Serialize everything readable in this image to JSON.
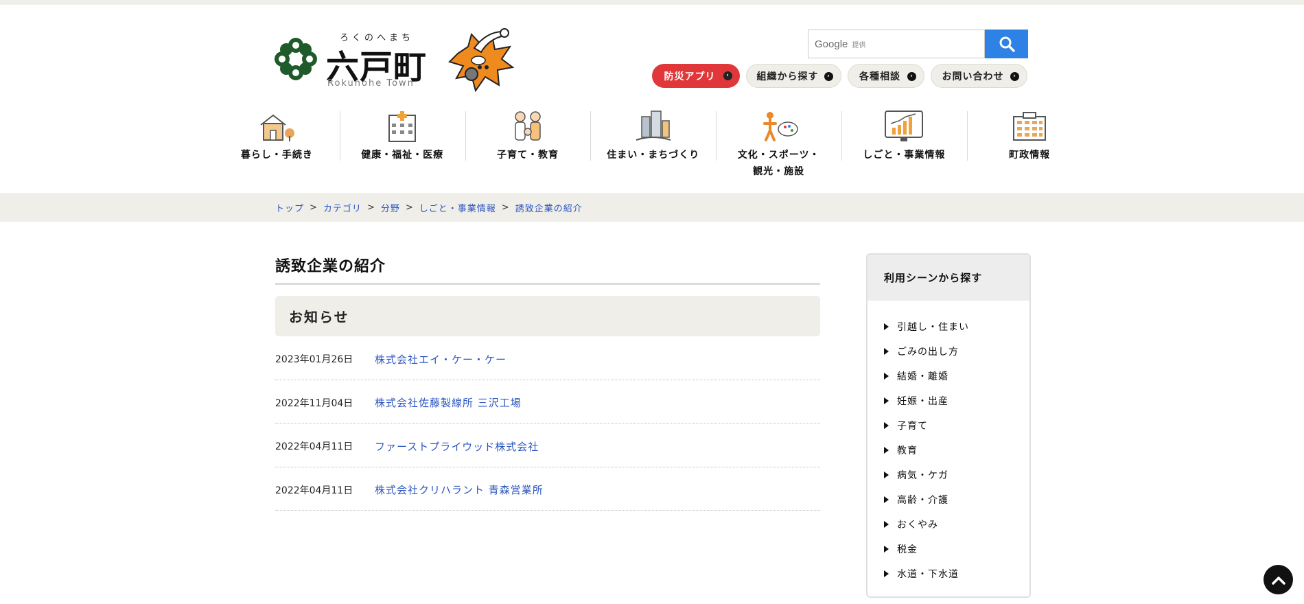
{
  "header": {
    "logo_ruby": "ろくのへまち",
    "logo_name": "六戸町",
    "logo_en": "Rokunohe Town",
    "search": {
      "brand": "Google",
      "provided": "提供",
      "placeholder": ""
    },
    "top_links": [
      {
        "label": "防災アプリ",
        "style": "red"
      },
      {
        "label": "組織から探す",
        "style": "grey"
      },
      {
        "label": "各種相談",
        "style": "grey"
      },
      {
        "label": "お問い合わせ",
        "style": "grey"
      }
    ]
  },
  "gnav": [
    {
      "label": "暮らし・手続き",
      "icon": "house-icon"
    },
    {
      "label": "健康・福祉・医療",
      "icon": "hospital-icon"
    },
    {
      "label": "子育て・教育",
      "icon": "family-icon"
    },
    {
      "label": "住まい・まちづくり",
      "icon": "town-icon"
    },
    {
      "label": "文化・スポーツ・\n観光・施設",
      "icon": "culture-icon"
    },
    {
      "label": "しごと・事業情報",
      "icon": "chart-board-icon"
    },
    {
      "label": "町政情報",
      "icon": "government-building-icon"
    }
  ],
  "breadcrumb": [
    "トップ",
    "カテゴリ",
    "分野",
    "しごと・事業情報",
    "誘致企業の紹介"
  ],
  "breadcrumb_sep": ">",
  "main": {
    "title": "誘致企業の紹介",
    "notice_heading": "お知らせ",
    "news": [
      {
        "date": "2023年01月26日",
        "title": "株式会社エイ・ケー・ケー"
      },
      {
        "date": "2022年11月04日",
        "title": "株式会社佐藤製線所 三沢工場"
      },
      {
        "date": "2022年04月11日",
        "title": "ファーストプライウッド株式会社"
      },
      {
        "date": "2022年04月11日",
        "title": "株式会社クリハラント 青森営業所"
      }
    ]
  },
  "sidebar": {
    "heading": "利用シーンから探す",
    "items": [
      "引越し・住まい",
      "ごみの出し方",
      "結婚・離婚",
      "妊娠・出産",
      "子育て",
      "教育",
      "病気・ケガ",
      "高齢・介護",
      "おくやみ",
      "税金",
      "水道・下水道"
    ]
  },
  "colors": {
    "accent_red": "#e0383a",
    "link_blue": "#2b55c0",
    "search_blue": "#2e82e6",
    "beige": "#efeee8",
    "emblem_green": "#1f5a2a",
    "mascot_orange": "#ef8a1e"
  }
}
